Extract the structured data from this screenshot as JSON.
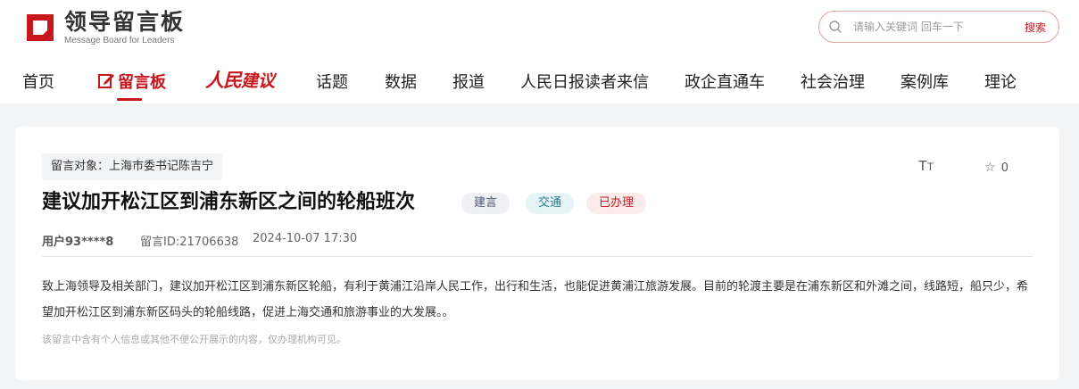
{
  "brand": {
    "title": "领导留言板",
    "subtitle": "Message Board for Leaders",
    "color": "#c8161d"
  },
  "search": {
    "placeholder": "请输入关键词 回车一下",
    "button_label": "搜索"
  },
  "nav": {
    "items": [
      {
        "label": "首页"
      },
      {
        "label": "留言板"
      },
      {
        "label": "人民建议",
        "logo_part1": "人民",
        "logo_part2": "建议"
      },
      {
        "label": "话题"
      },
      {
        "label": "数据"
      },
      {
        "label": "报道"
      },
      {
        "label": "人民日报读者来信"
      },
      {
        "label": "政企直通车"
      },
      {
        "label": "社会治理"
      },
      {
        "label": "案例库"
      },
      {
        "label": "理论"
      }
    ],
    "active": "留言板"
  },
  "message": {
    "target": "留言对象：上海市委书记陈吉宁",
    "title": "建议加开松江区到浦东新区之间的轮船班次",
    "tags": [
      {
        "label": "建言",
        "bg": "#eef0f4",
        "color": "#4a5670"
      },
      {
        "label": "交通",
        "bg": "#e7f4f7",
        "color": "#2b7e8c"
      },
      {
        "label": "已办理",
        "bg": "#fcebeb",
        "color": "#c8161d"
      }
    ],
    "user": "用户93****8",
    "id": "留言ID:21706638",
    "datetime": "2024-10-07 17:30",
    "body": "致上海领导及相关部门，建议加开松江区到浦东新区轮船，有利于黄浦江沿岸人民工作，出行和生活，也能促进黄浦江旅游发展。目前的轮渡主要是在浦东新区和外滩之间，线路短，船只少，希望加开松江区到浦东新区码头的轮船线路，促进上海交通和旅游事业的大发展。。",
    "notice": "该留言中含有个人信息或其他不便公开展示的内容，仅办理机构可见。",
    "favorites": "0",
    "font_size_label_big": "T",
    "font_size_label_small": "T"
  }
}
